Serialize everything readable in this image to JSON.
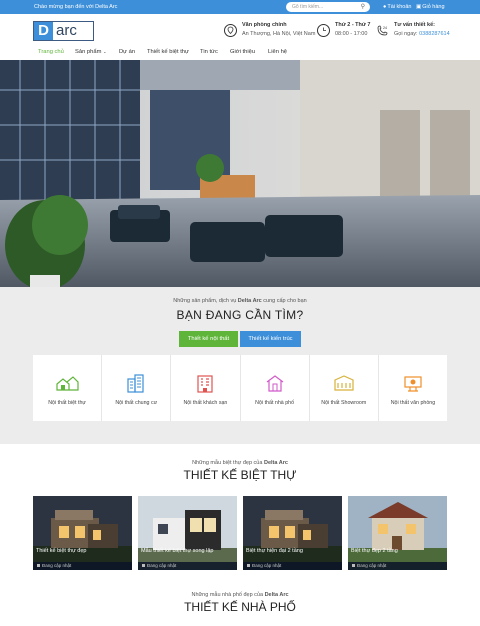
{
  "topbar": {
    "welcome": "Chào mừng bạn đến với Delta Arc",
    "search_placeholder": "Gõ tìm kiếm...",
    "account": "Tài khoản",
    "cart": "Giỏ hàng"
  },
  "logo": {
    "letter": "D",
    "text": "arc"
  },
  "header": {
    "office_title": "Văn phòng chính",
    "office_address": "An Thượng, Hà Nội, Việt Nam",
    "hours_title": "Thứ 2 - Thứ 7",
    "hours_time": "08:00 - 17:00",
    "consult_title": "Tư vấn thiết kế:",
    "consult_prefix": "Gọi ngay:",
    "consult_phone": "0388287614"
  },
  "nav": {
    "items": [
      "Trang chủ",
      "Sản phẩm",
      "Dự án",
      "Thiết kế biệt thự",
      "Tin tức",
      "Giới thiệu",
      "Liên hệ"
    ],
    "dropdown_icon": "chevron-down-icon"
  },
  "find": {
    "subtitle_prefix": "Những sản phẩm, dịch vụ",
    "subtitle_brand": "Delta Arc",
    "subtitle_suffix": "cung cấp cho bạn",
    "heading": "BẠN ĐANG CẦN TÌM?",
    "tab_interior": "Thiết kế nội thất",
    "tab_architecture": "Thiết kế kiến trúc",
    "cards": [
      {
        "label": "Nội thất biệt thự",
        "icon": "villa-icon",
        "color": "#5fb53a"
      },
      {
        "label": "Nội thất chung cư",
        "icon": "apartment-icon",
        "color": "#3d8fd9"
      },
      {
        "label": "Nội thất khách sạn",
        "icon": "hotel-icon",
        "color": "#e0544f"
      },
      {
        "label": "Nội thất nhà phố",
        "icon": "townhouse-icon",
        "color": "#d15ac9"
      },
      {
        "label": "Nội thất Showroom",
        "icon": "showroom-icon",
        "color": "#d7b23a"
      },
      {
        "label": "Nội thất văn phòng",
        "icon": "office-icon",
        "color": "#f0902a"
      }
    ]
  },
  "villa": {
    "subtitle_prefix": "Những mẫu biệt thự đẹp của",
    "subtitle_brand": "Delta Arc",
    "heading": "THIẾT KẾ BIỆT THỰ",
    "items": [
      {
        "title": "Thiết kế biệt thự đẹp",
        "status": "Đang cập nhật"
      },
      {
        "title": "Mẫu thiết kế biệt thự song lập",
        "status": "Đang cập nhật"
      },
      {
        "title": "Biệt thự hiện đại 2 tầng",
        "status": "Đang cập nhật"
      },
      {
        "title": "Biệt thự đẹp 2 tầng",
        "status": "Đang cập nhật"
      }
    ]
  },
  "town": {
    "subtitle_prefix": "Những mẫu nhà phố đẹp của",
    "subtitle_brand": "Delta Arc",
    "heading": "THIẾT KẾ NHÀ PHỐ"
  },
  "colors": {
    "primary": "#3d8fd9",
    "green": "#5fb53a"
  }
}
